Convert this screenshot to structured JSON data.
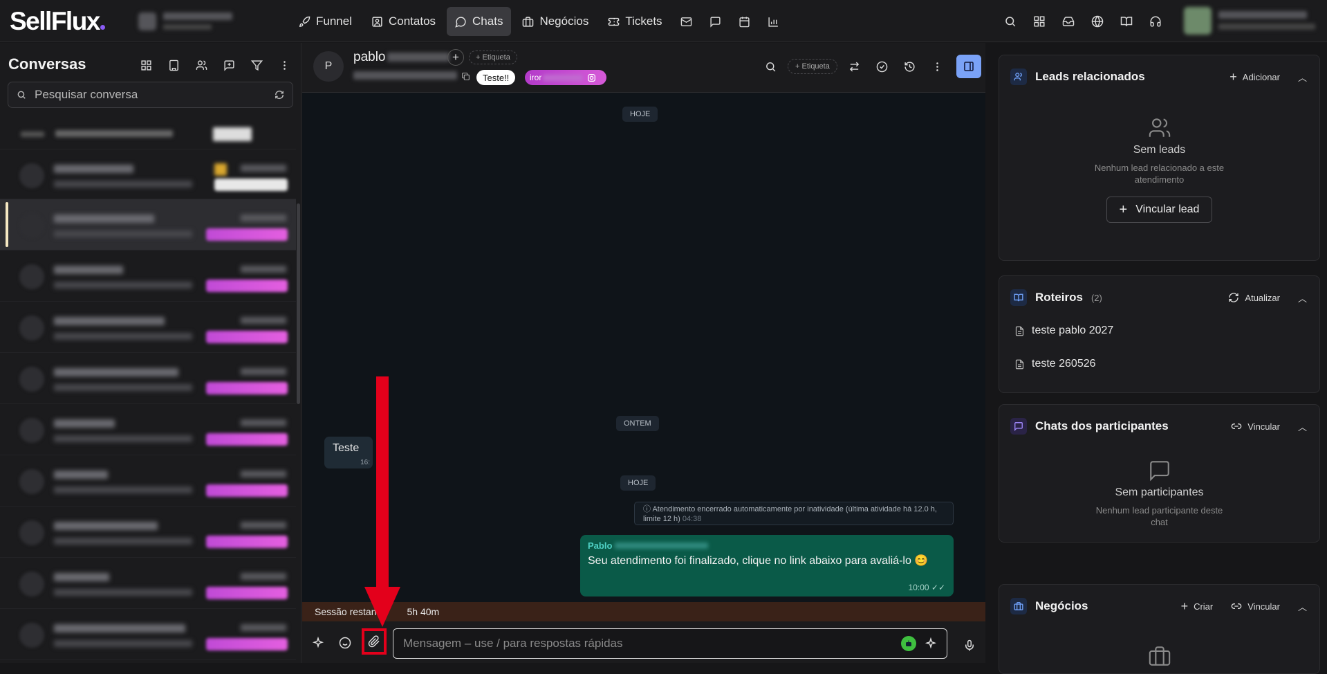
{
  "app": {
    "logo": "SellFlux"
  },
  "nav": {
    "items": [
      {
        "label": "Funnel",
        "icon": "rocket-icon"
      },
      {
        "label": "Contatos",
        "icon": "contact-card-icon"
      },
      {
        "label": "Chats",
        "icon": "chat-bubble-icon",
        "active": true
      },
      {
        "label": "Negócios",
        "icon": "briefcase-icon"
      },
      {
        "label": "Tickets",
        "icon": "ticket-icon"
      }
    ],
    "extra_icons": [
      "mail-icon",
      "message-square-icon",
      "calendar-icon",
      "bar-chart-icon"
    ],
    "right_icons": [
      "search-icon",
      "apps-grid-icon",
      "inbox-icon",
      "globe-icon",
      "book-icon",
      "headset-icon"
    ]
  },
  "sidebar": {
    "title": "Conversas",
    "actions": [
      "grid-icon",
      "building-icon",
      "users-icon",
      "add-message-icon",
      "filter-icon",
      "more-vertical-icon"
    ],
    "search_placeholder": "Pesquisar conversa"
  },
  "chat": {
    "avatar_letter": "P",
    "contact_name": "pablo",
    "add_tag_label": "+ Etiqueta",
    "tag_teste": "Teste!!",
    "tag_instagram": "iror",
    "header_tag_label": "+ Etiqueta",
    "messages": {
      "date_today_1": "HOJE",
      "date_yesterday": "ONTEM",
      "date_today_2": "HOJE",
      "incoming_text": "Teste",
      "incoming_time": "16:",
      "system_text": "Atendimento encerrado automaticamente por inatividade (última atividade há 12.0 h, limite 12 h)",
      "system_time": "04:38",
      "outgoing_sender": "Pablo",
      "outgoing_text": "Seu atendimento foi finalizado, clique no link abaixo para avaliá-lo 😊",
      "outgoing_time": "10:00"
    },
    "session_text": "Sessão restan",
    "session_remaining": "5h 40m",
    "input_placeholder": "Mensagem – use / para respostas rápidas"
  },
  "right_panel": {
    "leads": {
      "title": "Leads relacionados",
      "action": "Adicionar",
      "empty_title": "Sem leads",
      "empty_sub": "Nenhum lead relacionado a este atendimento",
      "button": "Vincular lead"
    },
    "roteiros": {
      "title": "Roteiros",
      "count": "(2)",
      "action": "Atualizar",
      "items": [
        "teste pablo 2027",
        "teste 260526"
      ]
    },
    "chats_participantes": {
      "title": "Chats dos participantes",
      "action": "Vincular",
      "empty_title": "Sem participantes",
      "empty_sub": "Nenhum lead participante deste chat"
    },
    "negocios": {
      "title": "Negócios",
      "action_create": "Criar",
      "action_link": "Vincular"
    }
  },
  "colors": {
    "accent_purple": "#8b5cf6",
    "annotation_red": "#e3001b",
    "outgoing_bubble": "#0a5a48",
    "panel_toggle_blue": "#7aa2f7"
  }
}
